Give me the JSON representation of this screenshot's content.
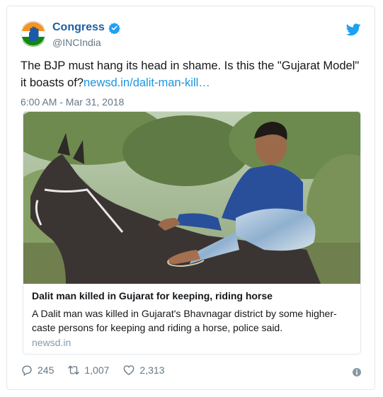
{
  "author": {
    "display_name": "Congress",
    "handle": "@INCIndia",
    "avatar_icon": "congress-hand-logo",
    "verified_icon": "verified-badge-icon"
  },
  "tweet": {
    "text_main": "The BJP must hang its head in shame. Is this the \"Gujarat Model\" it boasts of?",
    "link_text": "newsd.in/dalit-man-kill…",
    "timestamp": "6:00 AM - Mar 31, 2018"
  },
  "card": {
    "title": "Dalit man killed in Gujarat for keeping, riding horse",
    "description": "A Dalit man was killed in Gujarat's Bhavnagar district by some higher-caste persons for keeping and riding a horse, police said.",
    "domain": "newsd.in"
  },
  "actions": {
    "replies": "245",
    "retweets": "1,007",
    "likes": "2,313"
  },
  "colors": {
    "name_blue": "#1c5fa8",
    "link_blue": "#1b95e0",
    "twitter_blue": "#1da1f2",
    "muted": "#657786",
    "border": "#e1e8ed"
  }
}
